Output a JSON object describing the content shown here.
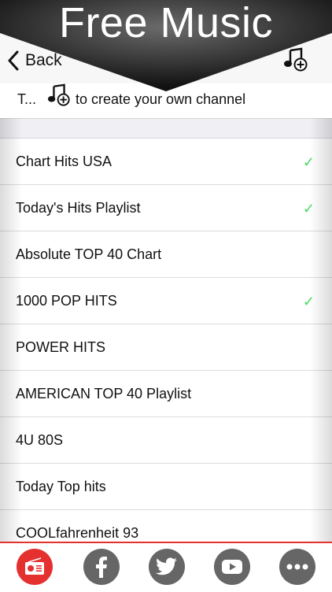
{
  "banner": {
    "title": "Free Music"
  },
  "nav": {
    "back_label": "Back",
    "add_icon": "music-note-plus-icon"
  },
  "hint": {
    "prefix": "T...",
    "suffix": "to create your own channel"
  },
  "channels": [
    {
      "name": "Chart Hits USA",
      "selected": true
    },
    {
      "name": "Today's Hits Playlist",
      "selected": true
    },
    {
      "name": "Absolute TOP 40 Chart",
      "selected": false
    },
    {
      "name": "1000 POP HITS",
      "selected": true
    },
    {
      "name": "POWER HITS",
      "selected": false
    },
    {
      "name": "AMERICAN TOP 40 Playlist",
      "selected": false
    },
    {
      "name": "4U 80S",
      "selected": false
    },
    {
      "name": "Today Top hits",
      "selected": false
    },
    {
      "name": "COOLfahrenheit 93",
      "selected": false
    }
  ],
  "check_glyph": "✓",
  "tabs": [
    {
      "icon": "radio-icon",
      "active": true
    },
    {
      "icon": "facebook-icon",
      "active": false
    },
    {
      "icon": "twitter-icon",
      "active": false
    },
    {
      "icon": "youtube-icon",
      "active": false
    },
    {
      "icon": "more-icon",
      "active": false
    }
  ],
  "colors": {
    "accent": "#e53030",
    "check": "#4cd964",
    "tab_inactive": "#666666"
  }
}
